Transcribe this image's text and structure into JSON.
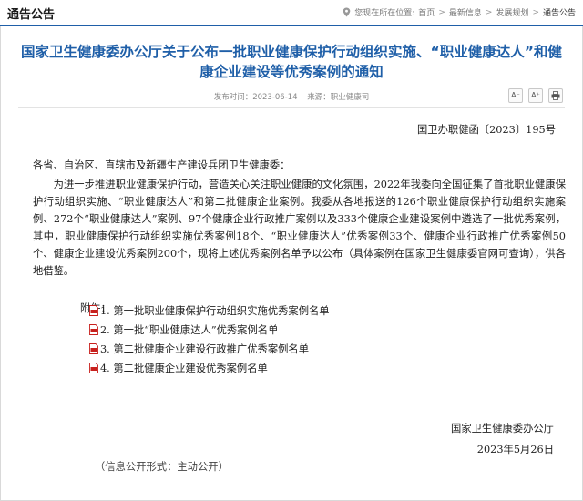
{
  "header": {
    "section_title": "通告公告",
    "breadcrumb": {
      "prefix": "您现在所在位置:",
      "items": [
        "首页",
        "最新信息",
        "发展规划",
        "通告公告"
      ],
      "separator": ">"
    }
  },
  "article": {
    "title": "国家卫生健康委办公厅关于公布一批职业健康保护行动组织实施、“职业健康达人”和健康企业建设等优秀案例的通知",
    "publish_date": "发布时间：2023-06-14",
    "source": "来源：职业健康司",
    "tools": {
      "font_smaller": "A⁻",
      "font_larger": "A⁺"
    },
    "doc_number": "国卫办职健函〔2023〕195号",
    "salutation": "各省、自治区、直辖市及新疆生产建设兵团卫生健康委：",
    "paragraph": "为进一步推进职业健康保护行动，营造关心关注职业健康的文化氛围，2022年我委向全国征集了首批职业健康保护行动组织实施、“职业健康达人”和第二批健康企业案例。我委从各地报送的126个职业健康保护行动组织实施案例、272个“职业健康达人”案例、97个健康企业行政推广案例以及333个健康企业建设案例中遴选了一批优秀案例，其中，职业健康保护行动组织实施优秀案例18个、“职业健康达人”优秀案例33个、健康企业行政推广优秀案例50个、健康企业建设优秀案例200个，现将上述优秀案例名单予以公布（具体案例在国家卫生健康委官网可查询），供各地借鉴。",
    "attachments_label": "附件：",
    "attachments": [
      "1. 第一批职业健康保护行动组织实施优秀案例名单",
      "2. 第一批“职业健康达人”优秀案例名单",
      "3. 第二批健康企业建设行政推广优秀案例名单",
      "4. 第二批健康企业建设优秀案例名单"
    ],
    "signature_org": "国家卫生健康委办公厅",
    "signature_date": "2023年5月26日",
    "disclosure": "（信息公开形式：主动公开）"
  },
  "colors": {
    "accent": "#1f5fa8",
    "pdf_red": "#c8201d"
  }
}
